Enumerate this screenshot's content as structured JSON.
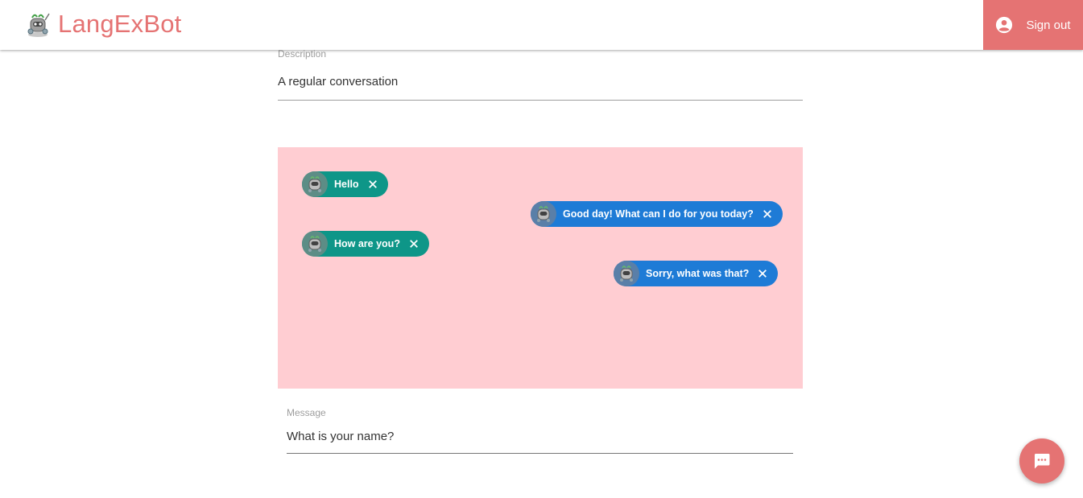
{
  "header": {
    "brand_name": "LangExBot",
    "signout_label": "Sign out",
    "brand_color": "#e57373"
  },
  "description": {
    "label": "Description",
    "value": "A regular conversation"
  },
  "conversation": {
    "background": "#ffcdd2",
    "messages": [
      {
        "speaker": "user",
        "text": "Hello"
      },
      {
        "speaker": "bot",
        "text": "Good day! What can I do for you today?"
      },
      {
        "speaker": "user",
        "text": "How are you?"
      },
      {
        "speaker": "bot",
        "text": "Sorry, what was that?"
      }
    ],
    "user_color": "#0e9688",
    "bot_color": "#1e7bd6"
  },
  "message": {
    "label": "Message",
    "value": "What is your name?"
  },
  "icons": {
    "brand": "robot-logo-icon",
    "account": "account-circle-icon",
    "chip_avatar": "robot-avatar-icon",
    "chip_remove": "close-icon",
    "fab": "chat-bubble-icon"
  }
}
